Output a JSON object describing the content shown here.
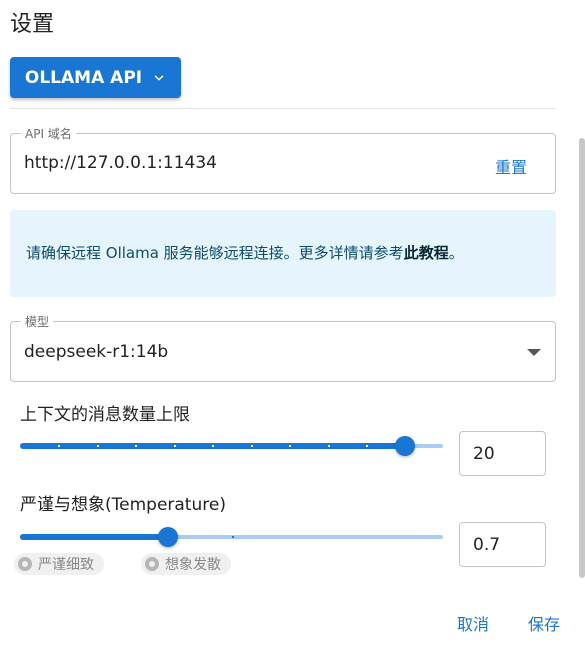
{
  "title": "设置",
  "provider": {
    "label": "OLLAMA API",
    "icon": "chevron-down-icon"
  },
  "api_host": {
    "legend": "API 域名",
    "value": "http://127.0.0.1:11434",
    "reset_label": "重置"
  },
  "info": {
    "text": "请确保远程 Ollama 服务能够远程连接。更多详情请参考",
    "link": "此教程",
    "suffix": "。"
  },
  "model": {
    "legend": "模型",
    "value": "deepseek-r1:14b"
  },
  "context_limit": {
    "label": "上下文的消息数量上限",
    "value": "20",
    "fraction": 0.91,
    "tick_count": 11
  },
  "temperature": {
    "label": "严谨与想象(Temperature)",
    "value": "0.7",
    "fraction": 0.35,
    "tick_count": 2
  },
  "temperature_chips": {
    "strict": "严谨细致",
    "imagine": "想象发散"
  },
  "actions": {
    "cancel": "取消",
    "save": "保存"
  },
  "colors": {
    "accent": "#1976d2",
    "info_bg": "#e5f4fd",
    "rail": "#a9cdf0"
  }
}
